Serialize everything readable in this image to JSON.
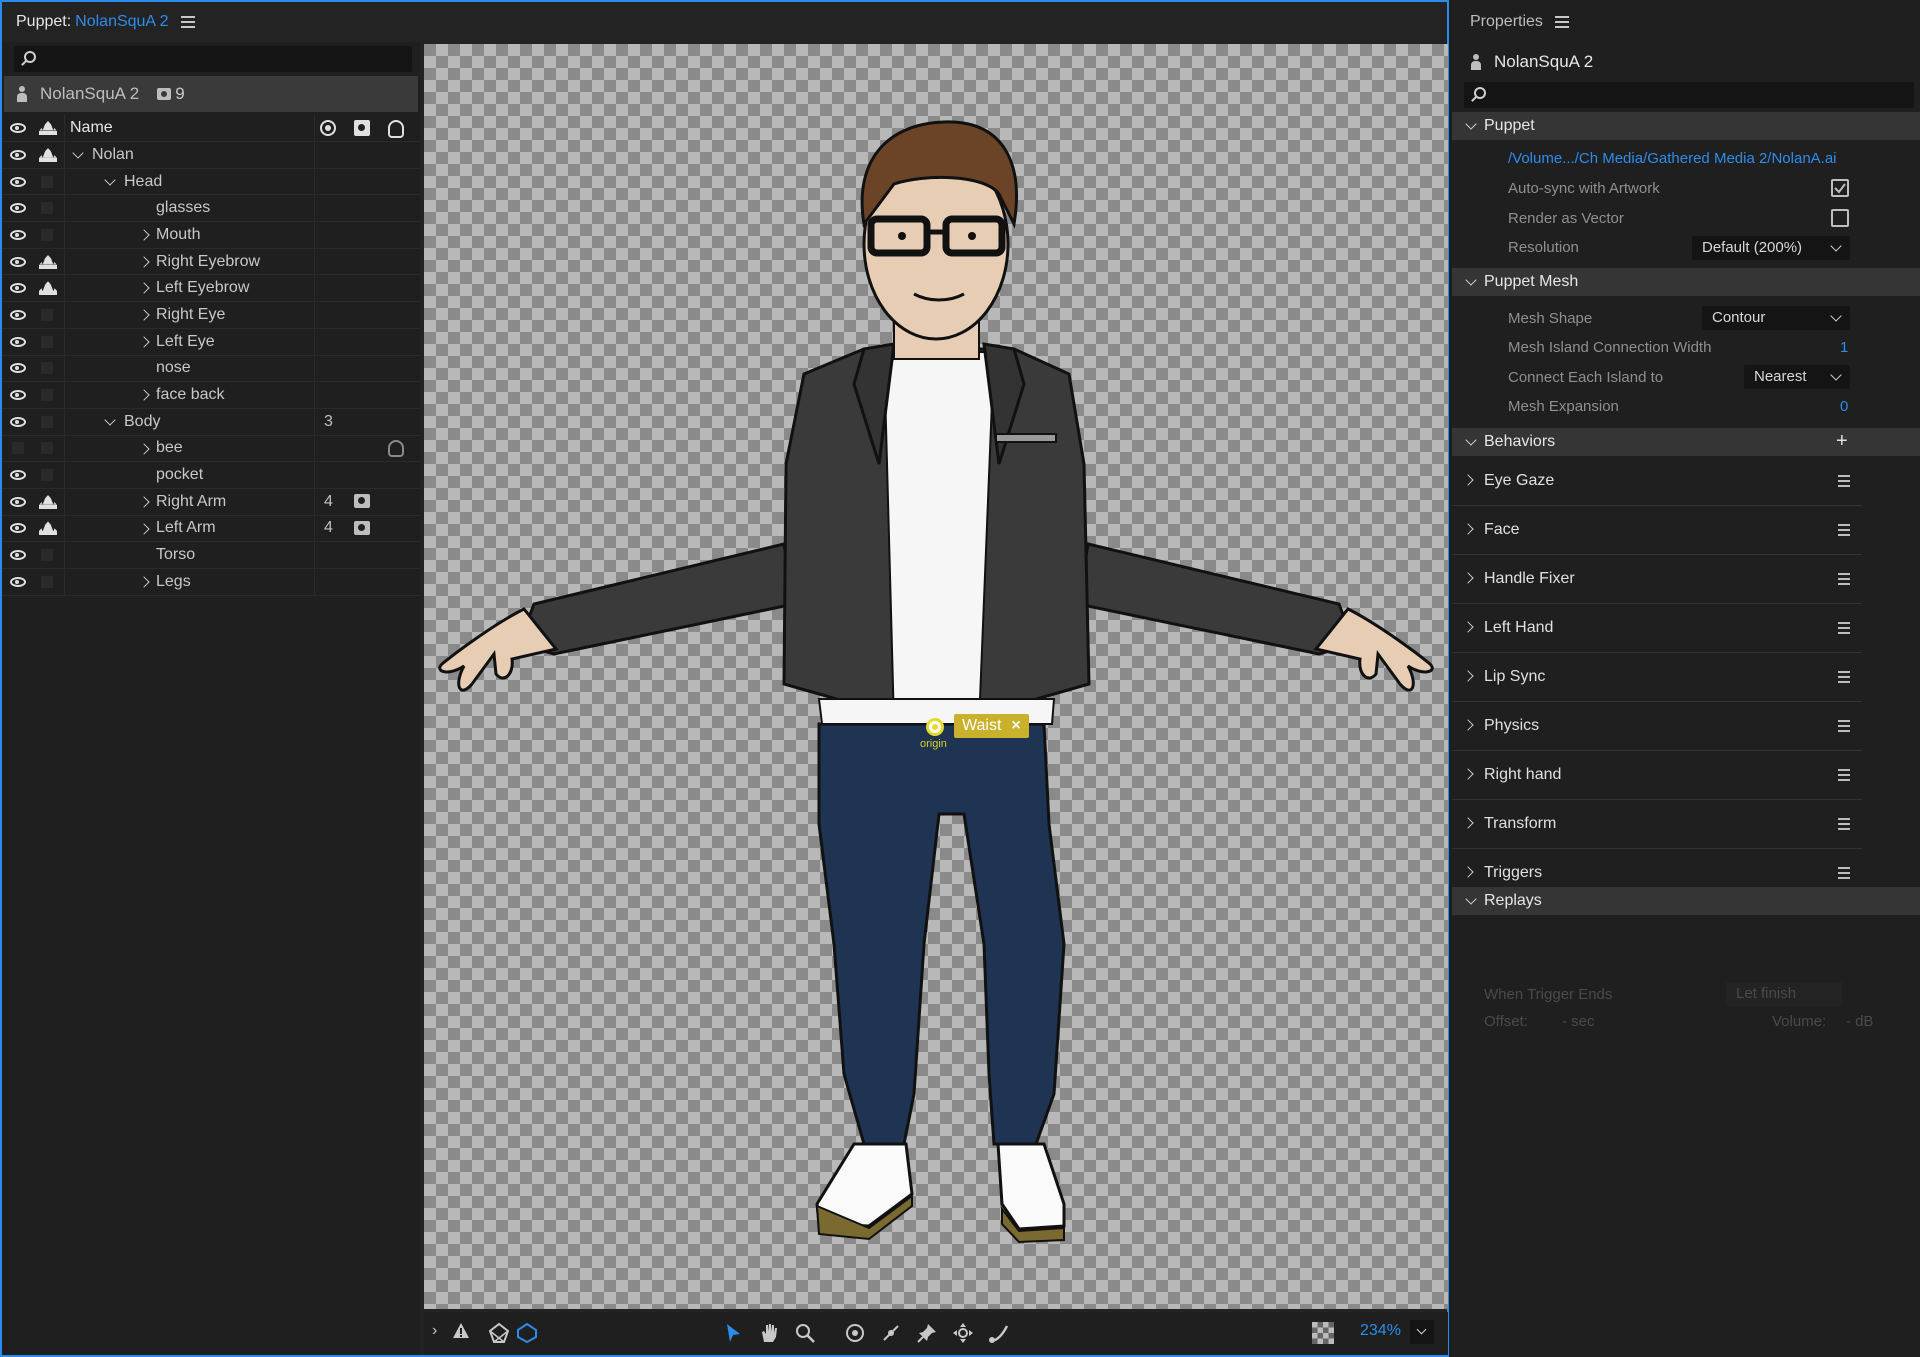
{
  "puppet_panel": {
    "title_prefix": "Puppet:",
    "title_name": "NolanSquA 2",
    "puppet_bar_name": "NolanSquA 2",
    "puppet_bar_count": "9",
    "column_name": "Name",
    "layers": [
      {
        "name": "Nolan",
        "visible": true,
        "crown": true,
        "indent": 0,
        "expander": "down",
        "count": ""
      },
      {
        "name": "Head",
        "visible": true,
        "crown": false,
        "indent": 1,
        "expander": "down",
        "count": ""
      },
      {
        "name": "glasses",
        "visible": true,
        "crown": false,
        "indent": 2,
        "expander": "none",
        "count": ""
      },
      {
        "name": "Mouth",
        "visible": true,
        "crown": false,
        "indent": 2,
        "expander": "right",
        "count": ""
      },
      {
        "name": "Right Eyebrow",
        "visible": true,
        "crown": true,
        "indent": 2,
        "expander": "right",
        "count": ""
      },
      {
        "name": "Left Eyebrow",
        "visible": true,
        "crown": true,
        "indent": 2,
        "expander": "right",
        "count": ""
      },
      {
        "name": "Right Eye",
        "visible": true,
        "crown": false,
        "indent": 2,
        "expander": "right",
        "count": ""
      },
      {
        "name": "Left Eye",
        "visible": true,
        "crown": false,
        "indent": 2,
        "expander": "right",
        "count": ""
      },
      {
        "name": "nose",
        "visible": true,
        "crown": false,
        "indent": 2,
        "expander": "none",
        "count": ""
      },
      {
        "name": "face back",
        "visible": true,
        "crown": false,
        "indent": 2,
        "expander": "right",
        "count": ""
      },
      {
        "name": "Body",
        "visible": true,
        "crown": false,
        "indent": 1,
        "expander": "down",
        "count": "3"
      },
      {
        "name": "bee",
        "visible": false,
        "crown": false,
        "indent": 2,
        "expander": "right",
        "count": "",
        "hand": true
      },
      {
        "name": "pocket",
        "visible": true,
        "crown": false,
        "indent": 2,
        "expander": "none",
        "count": ""
      },
      {
        "name": "Right Arm",
        "visible": true,
        "crown": true,
        "indent": 2,
        "expander": "right",
        "count": "4",
        "cam": true
      },
      {
        "name": "Left Arm",
        "visible": true,
        "crown": true,
        "indent": 2,
        "expander": "right",
        "count": "4",
        "cam": true
      },
      {
        "name": "Torso",
        "visible": true,
        "crown": false,
        "indent": 2,
        "expander": "none",
        "count": ""
      },
      {
        "name": "Legs",
        "visible": true,
        "crown": false,
        "indent": 2,
        "expander": "right",
        "count": ""
      }
    ]
  },
  "canvas": {
    "handle_tag": "Waist",
    "origin_label": "origin",
    "zoom": "234%"
  },
  "properties": {
    "header": "Properties",
    "title": "NolanSquA 2",
    "puppet_section": "Puppet",
    "file_path": "/Volume.../Ch Media/Gathered Media 2/NolanA.ai",
    "auto_sync_label": "Auto-sync with Artwork",
    "auto_sync_checked": true,
    "render_vector_label": "Render as Vector",
    "render_vector_checked": false,
    "resolution_label": "Resolution",
    "resolution_value": "Default (200%)",
    "mesh_section": "Puppet Mesh",
    "mesh_shape_label": "Mesh Shape",
    "mesh_shape_value": "Contour",
    "island_width_label": "Mesh Island Connection Width",
    "island_width_value": "1",
    "connect_label": "Connect Each Island to",
    "connect_value": "Nearest",
    "expansion_label": "Mesh Expansion",
    "expansion_value": "0",
    "behaviors_section": "Behaviors",
    "behaviors": [
      "Eye Gaze",
      "Face",
      "Handle Fixer",
      "Left Hand",
      "Lip Sync",
      "Physics",
      "Right hand",
      "Transform",
      "Triggers"
    ],
    "replays_section": "Replays",
    "when_trigger_ends_label": "When Trigger Ends",
    "when_trigger_ends_value": "Let finish",
    "offset_label": "Offset:",
    "offset_value": "- sec",
    "volume_label": "Volume:",
    "volume_value": "- dB"
  },
  "colors": {
    "accent": "#2d8ceb",
    "handle_tag": "#c9b12b"
  }
}
